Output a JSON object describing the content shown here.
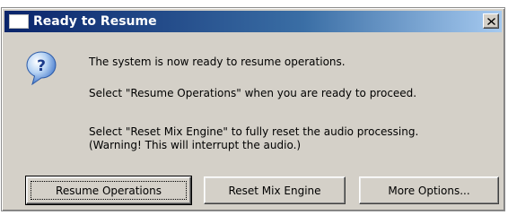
{
  "window": {
    "title": "Ready to Resume",
    "close_icon": "close-icon"
  },
  "dialog": {
    "icon": "question-icon",
    "icon_glyph": "?",
    "messages": [
      "The system is now ready to resume operations.",
      "Select \"Resume Operations\" when you are ready to proceed.",
      "Select \"Reset Mix Engine\" to fully reset the audio processing.",
      "(Warning! This will interrupt the audio.)"
    ]
  },
  "buttons": {
    "resume": "Resume Operations",
    "reset": "Reset Mix Engine",
    "more": "More Options..."
  }
}
